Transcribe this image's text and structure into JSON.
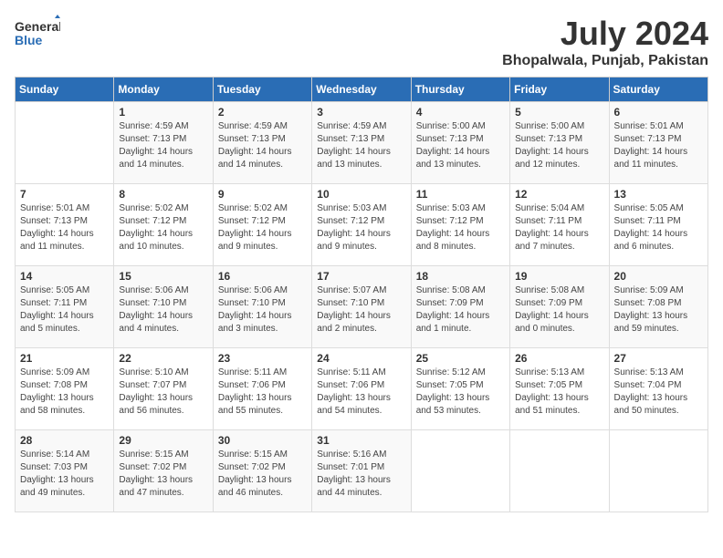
{
  "logo": {
    "text_general": "General",
    "text_blue": "Blue"
  },
  "title": "July 2024",
  "location": "Bhopalwala, Punjab, Pakistan",
  "weekdays": [
    "Sunday",
    "Monday",
    "Tuesday",
    "Wednesday",
    "Thursday",
    "Friday",
    "Saturday"
  ],
  "weeks": [
    [
      {
        "day": "",
        "info": ""
      },
      {
        "day": "1",
        "info": "Sunrise: 4:59 AM\nSunset: 7:13 PM\nDaylight: 14 hours\nand 14 minutes."
      },
      {
        "day": "2",
        "info": "Sunrise: 4:59 AM\nSunset: 7:13 PM\nDaylight: 14 hours\nand 14 minutes."
      },
      {
        "day": "3",
        "info": "Sunrise: 4:59 AM\nSunset: 7:13 PM\nDaylight: 14 hours\nand 13 minutes."
      },
      {
        "day": "4",
        "info": "Sunrise: 5:00 AM\nSunset: 7:13 PM\nDaylight: 14 hours\nand 13 minutes."
      },
      {
        "day": "5",
        "info": "Sunrise: 5:00 AM\nSunset: 7:13 PM\nDaylight: 14 hours\nand 12 minutes."
      },
      {
        "day": "6",
        "info": "Sunrise: 5:01 AM\nSunset: 7:13 PM\nDaylight: 14 hours\nand 11 minutes."
      }
    ],
    [
      {
        "day": "7",
        "info": "Sunrise: 5:01 AM\nSunset: 7:13 PM\nDaylight: 14 hours\nand 11 minutes."
      },
      {
        "day": "8",
        "info": "Sunrise: 5:02 AM\nSunset: 7:12 PM\nDaylight: 14 hours\nand 10 minutes."
      },
      {
        "day": "9",
        "info": "Sunrise: 5:02 AM\nSunset: 7:12 PM\nDaylight: 14 hours\nand 9 minutes."
      },
      {
        "day": "10",
        "info": "Sunrise: 5:03 AM\nSunset: 7:12 PM\nDaylight: 14 hours\nand 9 minutes."
      },
      {
        "day": "11",
        "info": "Sunrise: 5:03 AM\nSunset: 7:12 PM\nDaylight: 14 hours\nand 8 minutes."
      },
      {
        "day": "12",
        "info": "Sunrise: 5:04 AM\nSunset: 7:11 PM\nDaylight: 14 hours\nand 7 minutes."
      },
      {
        "day": "13",
        "info": "Sunrise: 5:05 AM\nSunset: 7:11 PM\nDaylight: 14 hours\nand 6 minutes."
      }
    ],
    [
      {
        "day": "14",
        "info": "Sunrise: 5:05 AM\nSunset: 7:11 PM\nDaylight: 14 hours\nand 5 minutes."
      },
      {
        "day": "15",
        "info": "Sunrise: 5:06 AM\nSunset: 7:10 PM\nDaylight: 14 hours\nand 4 minutes."
      },
      {
        "day": "16",
        "info": "Sunrise: 5:06 AM\nSunset: 7:10 PM\nDaylight: 14 hours\nand 3 minutes."
      },
      {
        "day": "17",
        "info": "Sunrise: 5:07 AM\nSunset: 7:10 PM\nDaylight: 14 hours\nand 2 minutes."
      },
      {
        "day": "18",
        "info": "Sunrise: 5:08 AM\nSunset: 7:09 PM\nDaylight: 14 hours\nand 1 minute."
      },
      {
        "day": "19",
        "info": "Sunrise: 5:08 AM\nSunset: 7:09 PM\nDaylight: 14 hours\nand 0 minutes."
      },
      {
        "day": "20",
        "info": "Sunrise: 5:09 AM\nSunset: 7:08 PM\nDaylight: 13 hours\nand 59 minutes."
      }
    ],
    [
      {
        "day": "21",
        "info": "Sunrise: 5:09 AM\nSunset: 7:08 PM\nDaylight: 13 hours\nand 58 minutes."
      },
      {
        "day": "22",
        "info": "Sunrise: 5:10 AM\nSunset: 7:07 PM\nDaylight: 13 hours\nand 56 minutes."
      },
      {
        "day": "23",
        "info": "Sunrise: 5:11 AM\nSunset: 7:06 PM\nDaylight: 13 hours\nand 55 minutes."
      },
      {
        "day": "24",
        "info": "Sunrise: 5:11 AM\nSunset: 7:06 PM\nDaylight: 13 hours\nand 54 minutes."
      },
      {
        "day": "25",
        "info": "Sunrise: 5:12 AM\nSunset: 7:05 PM\nDaylight: 13 hours\nand 53 minutes."
      },
      {
        "day": "26",
        "info": "Sunrise: 5:13 AM\nSunset: 7:05 PM\nDaylight: 13 hours\nand 51 minutes."
      },
      {
        "day": "27",
        "info": "Sunrise: 5:13 AM\nSunset: 7:04 PM\nDaylight: 13 hours\nand 50 minutes."
      }
    ],
    [
      {
        "day": "28",
        "info": "Sunrise: 5:14 AM\nSunset: 7:03 PM\nDaylight: 13 hours\nand 49 minutes."
      },
      {
        "day": "29",
        "info": "Sunrise: 5:15 AM\nSunset: 7:02 PM\nDaylight: 13 hours\nand 47 minutes."
      },
      {
        "day": "30",
        "info": "Sunrise: 5:15 AM\nSunset: 7:02 PM\nDaylight: 13 hours\nand 46 minutes."
      },
      {
        "day": "31",
        "info": "Sunrise: 5:16 AM\nSunset: 7:01 PM\nDaylight: 13 hours\nand 44 minutes."
      },
      {
        "day": "",
        "info": ""
      },
      {
        "day": "",
        "info": ""
      },
      {
        "day": "",
        "info": ""
      }
    ]
  ]
}
